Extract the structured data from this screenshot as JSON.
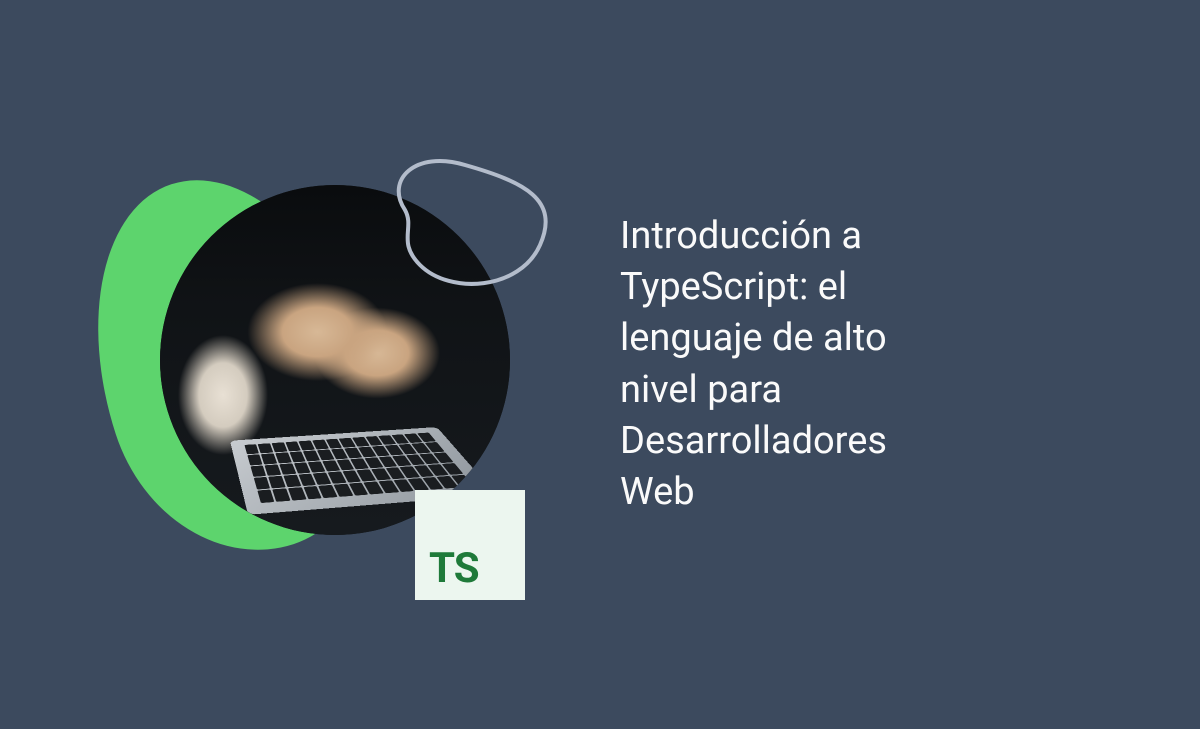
{
  "title": "Introducción a TypeScript: el lenguaje de alto nivel para Desarrolladores Web",
  "badge": {
    "label": "TS"
  },
  "colors": {
    "background": "#3c4a5e",
    "accent_green": "#5dd46d",
    "badge_bg": "#ecf6ef",
    "badge_text": "#1f7a3a",
    "text": "#fafafa"
  }
}
